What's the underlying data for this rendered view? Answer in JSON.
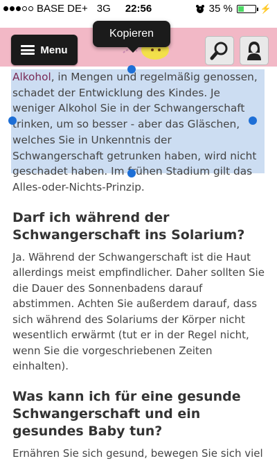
{
  "status_bar": {
    "carrier": "BASE DE+",
    "network": "3G",
    "time": "22:56",
    "battery": "35 %",
    "battery_level": 0.35
  },
  "header": {
    "menu_label": "Menu",
    "bg_color": "#f2b8c6"
  },
  "tooltip": {
    "label": "Kopieren"
  },
  "article": {
    "selected_link": "Alkohol",
    "selected_text": ", in Mengen und regelmäßig genossen, schadet der Entwicklung des Kindes. Je weniger Alkohol Sie in der Schwangerschaft trinken, um so besser - aber das Gläschen, welches Sie in Unkenntnis der Schwangerschaft getrunken haben, wird nicht geschadet haben. Im frühen Stadium gilt das Alles-oder-Nichts-Prinzip.",
    "heading1": "Darf ich während der Schwangerschaft ins Solarium?",
    "paragraph1": "Ja. Während der Schwangerschaft ist die Haut allerdings meist empfindlicher. Daher sollten Sie die Dauer des Sonnenbadens darauf abstimmen. Achten Sie außerdem darauf, dass sich während des Solariums der Körper nicht wesentlich erwärmt (tut er in der Regel nicht, wenn Sie die vorgeschriebenen Zeiten einhalten).",
    "heading2": "Was kann ich für eine gesunde Schwangerschaft und ein gesundes Baby tun?",
    "paragraph2": "Ernähren Sie sich gesund, bewegen Sie sich viel"
  },
  "icons": {
    "search": "magnifier-icon",
    "profile": "user-avatar-icon",
    "selection_color": "#78a5dc",
    "link_color": "#7a2a56"
  }
}
